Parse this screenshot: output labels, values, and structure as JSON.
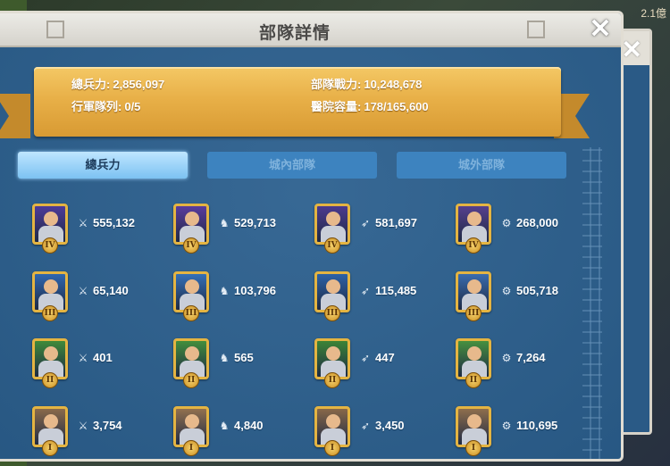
{
  "title": "部隊詳情",
  "corner_text": "2.1億",
  "close_label": "✕",
  "stats": {
    "total_power_label": "總兵力:",
    "total_power": "2,856,097",
    "march_label": "行軍隊列:",
    "march": "0/5",
    "troop_power_label": "部隊戰力:",
    "troop_power": "10,248,678",
    "hospital_label": "醫院容量:",
    "hospital": "178/165,600"
  },
  "tabs": [
    {
      "label": "總兵力",
      "active": true
    },
    {
      "label": "城內部隊",
      "active": false
    },
    {
      "label": "城外部隊",
      "active": false
    }
  ],
  "troops": [
    {
      "type": "infantry-icon",
      "glyph": "⚔",
      "tier": "IV",
      "count": "555,132",
      "color": "#4e3b9a"
    },
    {
      "type": "cavalry-icon",
      "glyph": "♞",
      "tier": "IV",
      "count": "529,713",
      "color": "#5a3c9e"
    },
    {
      "type": "archer-icon",
      "glyph": "➶",
      "tier": "IV",
      "count": "581,697",
      "color": "#4c3a8f"
    },
    {
      "type": "siege-icon",
      "glyph": "⚙",
      "tier": "IV",
      "count": "268,000",
      "color": "#56408e"
    },
    {
      "type": "infantry-icon",
      "glyph": "⚔",
      "tier": "III",
      "count": "65,140",
      "color": "#2f67b0"
    },
    {
      "type": "cavalry-icon",
      "glyph": "♞",
      "tier": "III",
      "count": "103,796",
      "color": "#3470b8"
    },
    {
      "type": "archer-icon",
      "glyph": "➶",
      "tier": "III",
      "count": "115,485",
      "color": "#2d62a6"
    },
    {
      "type": "siege-icon",
      "glyph": "⚙",
      "tier": "III",
      "count": "505,718",
      "color": "#3a6cae"
    },
    {
      "type": "infantry-icon",
      "glyph": "⚔",
      "tier": "II",
      "count": "401",
      "color": "#3f8a3a"
    },
    {
      "type": "cavalry-icon",
      "glyph": "♞",
      "tier": "II",
      "count": "565",
      "color": "#438e3c"
    },
    {
      "type": "archer-icon",
      "glyph": "➶",
      "tier": "II",
      "count": "447",
      "color": "#3c8436"
    },
    {
      "type": "siege-icon",
      "glyph": "⚙",
      "tier": "II",
      "count": "7,264",
      "color": "#47903f"
    },
    {
      "type": "infantry-icon",
      "glyph": "⚔",
      "tier": "I",
      "count": "3,754",
      "color": "#8a6a4a"
    },
    {
      "type": "cavalry-icon",
      "glyph": "♞",
      "tier": "I",
      "count": "4,840",
      "color": "#92704e"
    },
    {
      "type": "archer-icon",
      "glyph": "➶",
      "tier": "I",
      "count": "3,450",
      "color": "#886848"
    },
    {
      "type": "siege-icon",
      "glyph": "⚙",
      "tier": "I",
      "count": "110,695",
      "color": "#8e6e4c"
    }
  ]
}
